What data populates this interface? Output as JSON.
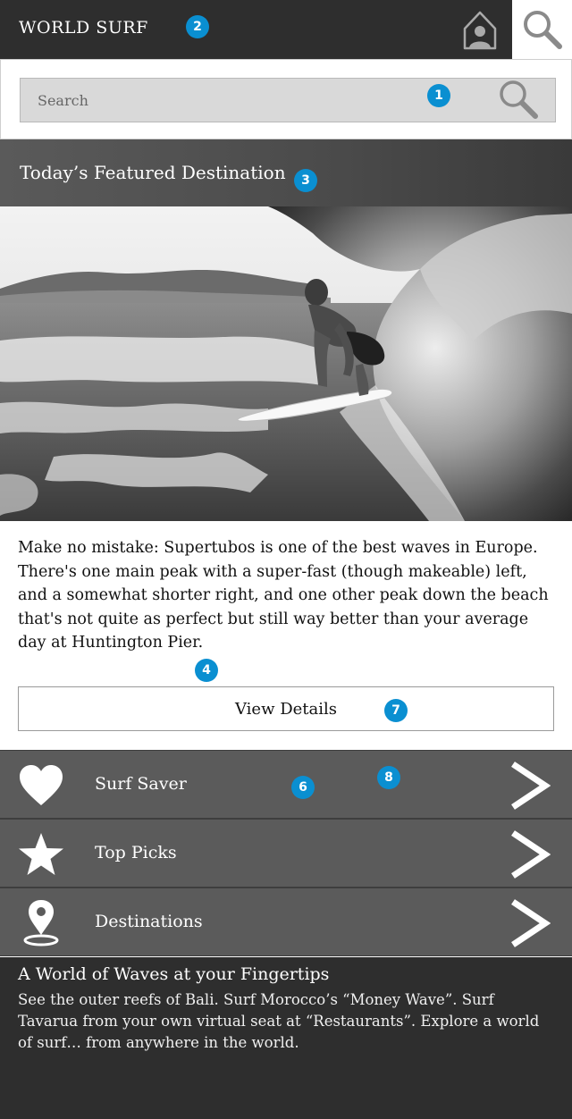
{
  "header": {
    "brand": "WORLD SURF",
    "home_icon": "home-user-icon",
    "search_icon": "search-icon"
  },
  "search": {
    "placeholder": "Search",
    "icon": "search-icon"
  },
  "featured": {
    "title": "Today’s Featured Destination",
    "image": "surfer-barrel-wave-photo",
    "description": "Make no mistake: Supertubos is one of the best waves in Europe. There's one main peak with a super-fast (though makeable) left, and a somewhat shorter right, and one other peak down the beach that's not quite as perfect but still way better than your average day at Huntington Pier.",
    "button_label": "View Details"
  },
  "menu": {
    "items": [
      {
        "label": "Surf Saver",
        "icon": "heart-icon"
      },
      {
        "label": "Top Picks",
        "icon": "star-icon"
      },
      {
        "label": "Destinations",
        "icon": "map-pin-icon"
      }
    ],
    "chevron_icon": "chevron-right-icon"
  },
  "footer": {
    "title": "A World of Waves at your Fingertips",
    "text": "See the outer reefs of Bali. Surf Morocco’s “Money Wave”. Surf Tavarua from your own virtual seat at “Restaurants”. Explore a world of surf… from anywhere in the world."
  },
  "annotations": [
    "1",
    "2",
    "3",
    "4",
    "6",
    "7",
    "8"
  ],
  "colors": {
    "topbar": "#2e2e2e",
    "badge": "#0a8fd1",
    "menu_row": "#5b5b5b",
    "footer": "#2e2e2e"
  }
}
